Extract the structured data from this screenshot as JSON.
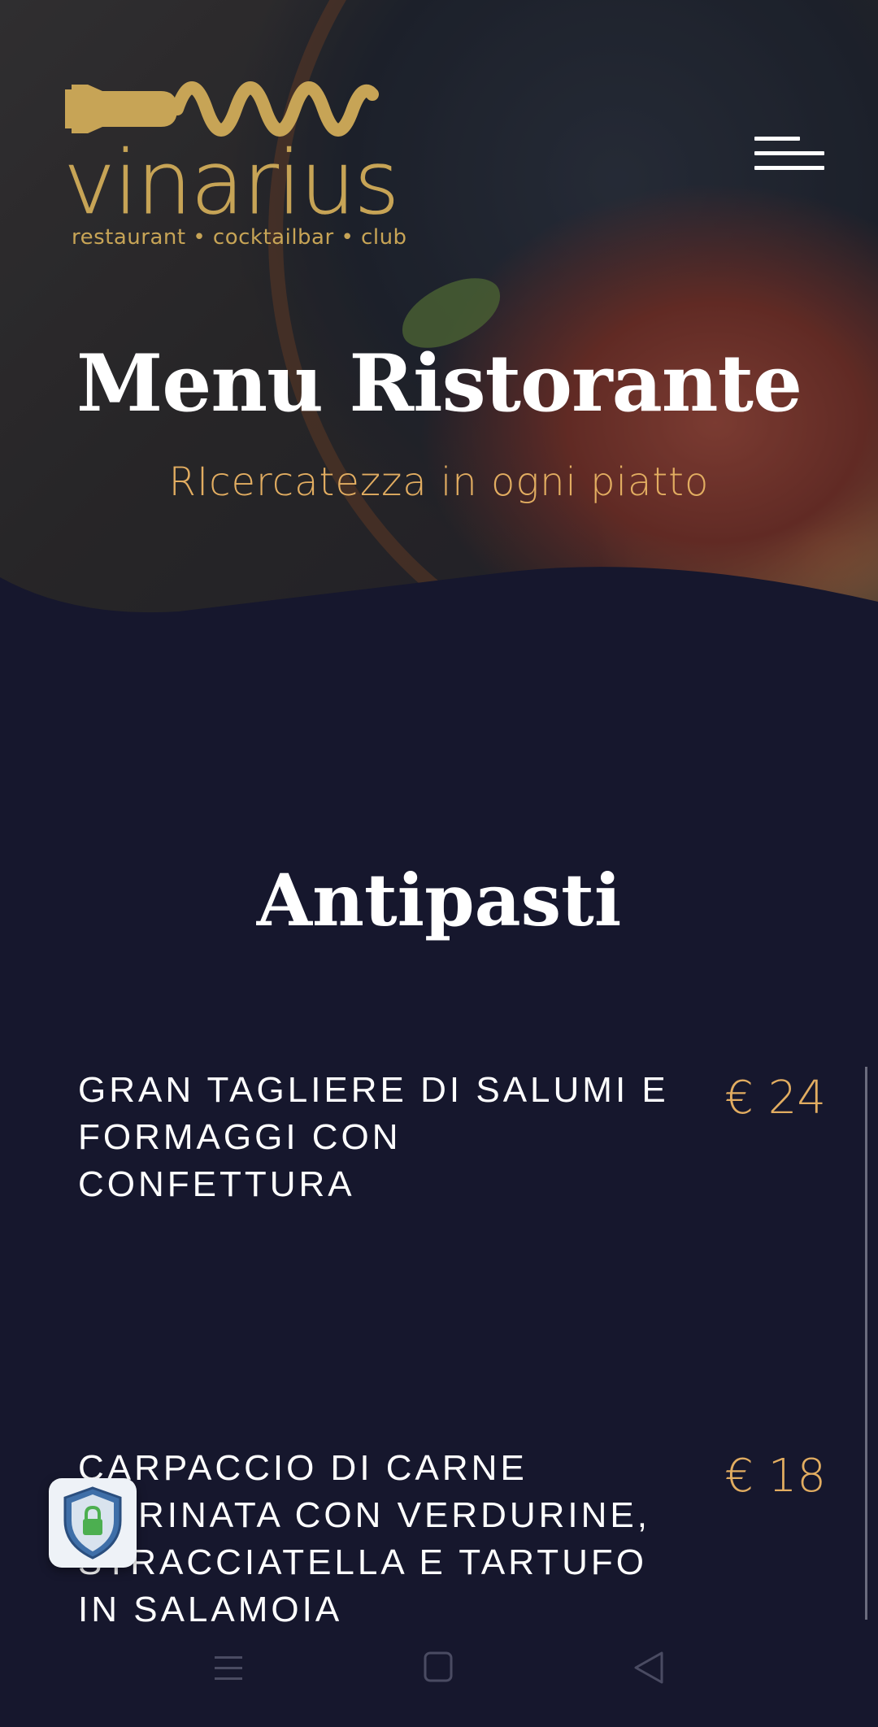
{
  "brand": {
    "name": "vinarius",
    "tagline": "restaurant • cocktailbar • club",
    "gold": "#c7a456"
  },
  "hero": {
    "title": "Menu Ristorante",
    "subtitle": "RIcercatezza in ogni piatto"
  },
  "header": {
    "menu_icon": "hamburger-menu-icon"
  },
  "section": {
    "title": "Antipasti"
  },
  "menu_items": [
    {
      "name": "Gran tagliere di salumi e formaggi con confettura",
      "price": "€ 24"
    },
    {
      "name": "Carpaccio di carne marinata con verdurine, stracciatella e tartufo in salamoia",
      "price": "€ 18"
    }
  ],
  "privacy_badge": {
    "icon": "shield-lock-icon"
  },
  "system_nav": {
    "recents_icon": "recents-menu-icon",
    "home_icon": "home-square-icon",
    "back_icon": "back-triangle-icon"
  },
  "colors": {
    "background": "#16172d",
    "accent": "#e2ad61",
    "text": "#ffffff"
  }
}
